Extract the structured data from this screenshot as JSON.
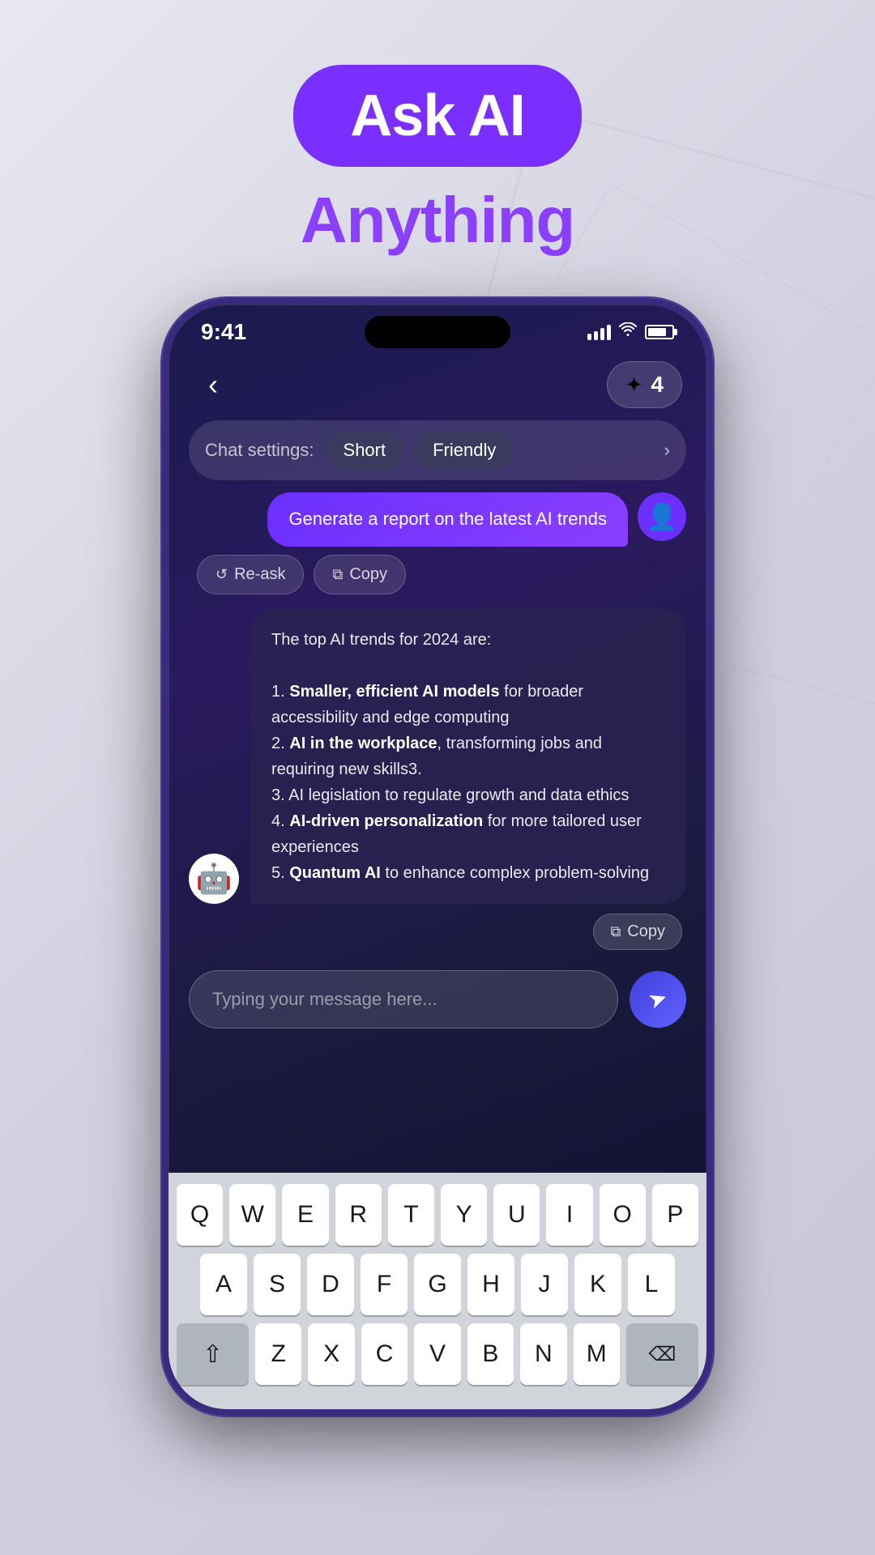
{
  "app": {
    "title": "Ask AI Anything",
    "badge_text": "Ask AI",
    "subtitle": "Anything"
  },
  "status_bar": {
    "time": "9:41",
    "signal": "signal",
    "wifi": "wifi",
    "battery": "battery"
  },
  "header": {
    "back_label": "‹",
    "credits_icon": "✦",
    "credits_count": "4"
  },
  "chat_settings": {
    "label": "Chat settings:",
    "mode1": "Short",
    "mode2": "Friendly",
    "chevron": "›"
  },
  "messages": [
    {
      "type": "user",
      "text": "Generate a report on the latest AI trends"
    },
    {
      "type": "ai",
      "text": "The top AI trends for 2024 are:\n\n1. Smaller, efficient AI models for broader accessibility and edge computing\n2. AI in the workplace, transforming jobs and requiring new skills3.\n3. AI legislation to regulate growth and data ethics\n4. AI-driven personalization for more tailored user experiences\n5. Quantum AI to enhance complex problem-solving"
    }
  ],
  "actions": {
    "reask_label": "Re-ask",
    "copy_label": "Copy",
    "copy_sm_label": "Copy"
  },
  "input": {
    "placeholder": "Typing your message here..."
  },
  "keyboard": {
    "rows": [
      [
        "Q",
        "W",
        "E",
        "R",
        "T",
        "Y",
        "U",
        "I",
        "O",
        "P"
      ],
      [
        "A",
        "S",
        "D",
        "F",
        "G",
        "H",
        "J",
        "K",
        "L"
      ],
      [
        "⇧",
        "Z",
        "X",
        "C",
        "V",
        "B",
        "N",
        "M",
        "⌫"
      ]
    ]
  }
}
